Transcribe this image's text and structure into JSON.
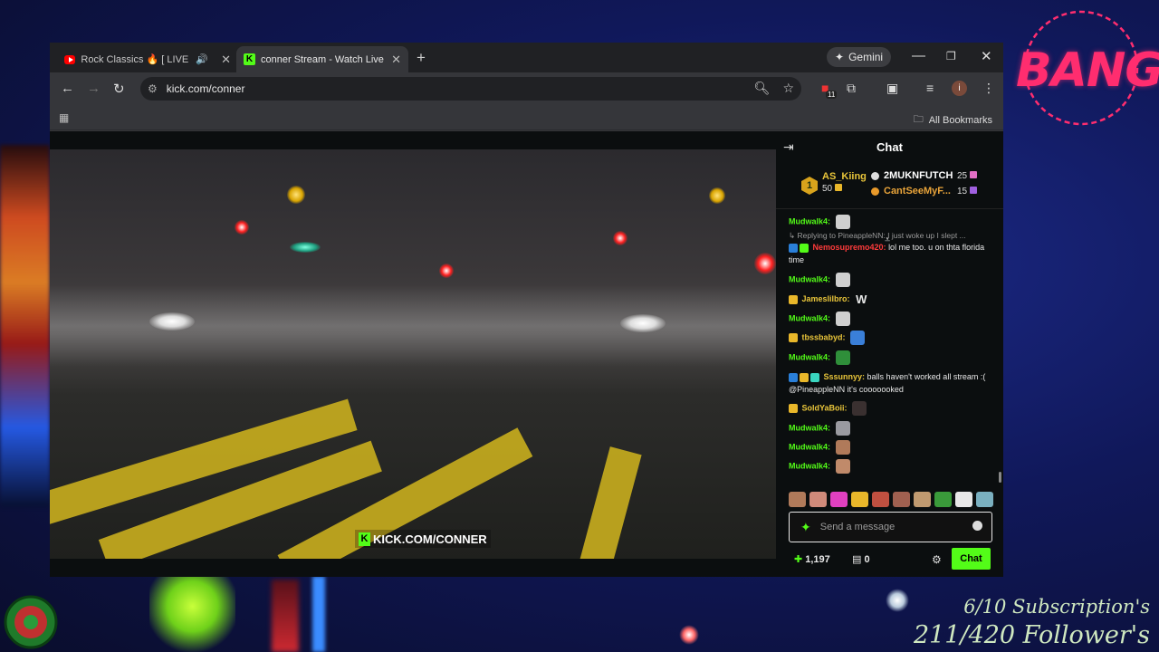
{
  "overlay": {
    "brand": "BANG",
    "sub_goal": "6/10 Subscription's",
    "follower_goal": "211/420 Follower's"
  },
  "browser": {
    "tabs": [
      {
        "label": "Rock Classics 🔥 [ LIVE ] Ti",
        "icon": "youtube-icon",
        "active": false
      },
      {
        "label": "conner Stream - Watch Live on",
        "icon": "kick-icon",
        "active": true
      }
    ],
    "new_tab": "+",
    "gemini_label": "Gemini",
    "url": "kick.com/conner",
    "extensions_badge": "11",
    "profile_initial": "i",
    "bookmarks_label": "All Bookmarks"
  },
  "video": {
    "watermark": "KICK.COM/CONNER"
  },
  "chat": {
    "title": "Chat",
    "leaderboard": {
      "rank_badge": "1",
      "top": {
        "name": "AS_Kiing",
        "count": "50"
      },
      "second": {
        "name": "2MUKNFUTCH",
        "count": "25"
      },
      "third": {
        "name": "CantSeeMyF...",
        "count": "15"
      }
    },
    "messages": [
      {
        "user": "Mudwalk4:",
        "color": "#53fc18",
        "text": ""
      },
      {
        "reply": "Replying to PineappleNN: I just woke up I slept ..."
      },
      {
        "user": "Nemosupremo420:",
        "color": "#ff3b3b",
        "text": "lol me too. u on thta florida time"
      },
      {
        "user": "Mudwalk4:",
        "color": "#53fc18",
        "text": ""
      },
      {
        "user": "Jameslilbro:",
        "color": "#e9c53a",
        "text": "W"
      },
      {
        "user": "Mudwalk4:",
        "color": "#53fc18",
        "text": ""
      },
      {
        "user": "tbssbabyd:",
        "color": "#e9c53a",
        "text": ""
      },
      {
        "user": "Mudwalk4:",
        "color": "#53fc18",
        "text": ""
      },
      {
        "user": "Sssunnyy:",
        "color": "#e9c53a",
        "text": "balls haven't worked all stream :( @PineappleNN it's cooooooked"
      },
      {
        "user": "SoldYaBoii:",
        "color": "#e9c53a",
        "text": ""
      },
      {
        "user": "Mudwalk4:",
        "color": "#53fc18",
        "text": ""
      },
      {
        "user": "Mudwalk4:",
        "color": "#53fc18",
        "text": ""
      },
      {
        "user": "Mudwalk4:",
        "color": "#53fc18",
        "text": ""
      }
    ],
    "input_placeholder": "Send a message",
    "points": "1,197",
    "store_count": "0",
    "send_label": "Chat",
    "accent": "#53fc18"
  }
}
